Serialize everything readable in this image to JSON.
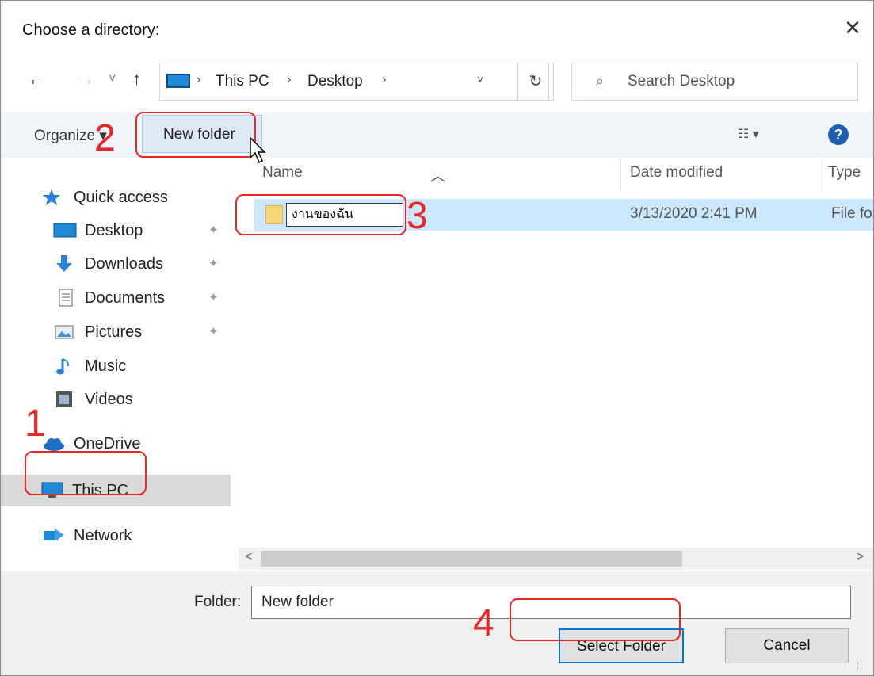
{
  "dialog": {
    "title": "Choose a directory:",
    "close_glyph": "✕"
  },
  "nav": {
    "back_glyph": "←",
    "forward_glyph": "→",
    "recent_glyph": "˅",
    "up_glyph": "↑",
    "breadcrumbs": [
      "This PC",
      "Desktop"
    ],
    "crumb_separator": "›",
    "dropdown_glyph": "˅",
    "refresh_glyph": "↻",
    "search_placeholder": "Search Desktop",
    "search_icon_glyph": "⌕"
  },
  "toolbar": {
    "organize_label": "Organize ▾",
    "new_folder_label": "New folder",
    "view_glyph": "☷ ▾",
    "help_glyph": "?"
  },
  "sidebar": {
    "items": [
      {
        "label": "Quick access",
        "icon": "star-icon",
        "pinned": false
      },
      {
        "label": "Desktop",
        "icon": "desktop-icon",
        "pinned": true
      },
      {
        "label": "Downloads",
        "icon": "download-icon",
        "pinned": true
      },
      {
        "label": "Documents",
        "icon": "documents-icon",
        "pinned": true
      },
      {
        "label": "Pictures",
        "icon": "pictures-icon",
        "pinned": true
      },
      {
        "label": "Music",
        "icon": "music-icon",
        "pinned": false
      },
      {
        "label": "Videos",
        "icon": "videos-icon",
        "pinned": false
      },
      {
        "label": "OneDrive",
        "icon": "cloud-icon",
        "pinned": false
      },
      {
        "label": "This PC",
        "icon": "pc-icon",
        "pinned": false,
        "selected": true
      },
      {
        "label": "Network",
        "icon": "network-icon",
        "pinned": false
      }
    ],
    "pin_glyph": "✦"
  },
  "columns": {
    "name": "Name",
    "date": "Date modified",
    "type": "Type"
  },
  "files": [
    {
      "name": "งานของฉัน",
      "date": "3/13/2020 2:41 PM",
      "type": "File fo"
    }
  ],
  "scroll": {
    "left_glyph": "<",
    "right_glyph": ">"
  },
  "footer": {
    "folder_label": "Folder:",
    "folder_value": "New folder",
    "select_label": "Select Folder",
    "cancel_label": "Cancel",
    "grip_glyph": "⁞"
  },
  "annotations": {
    "marks": [
      "1",
      "2",
      "3",
      "4"
    ],
    "color": "#e8262a"
  },
  "colors": {
    "selection": "#cce8ff",
    "accent": "#0078d7",
    "toolbar_bg": "#f1f5f9"
  }
}
